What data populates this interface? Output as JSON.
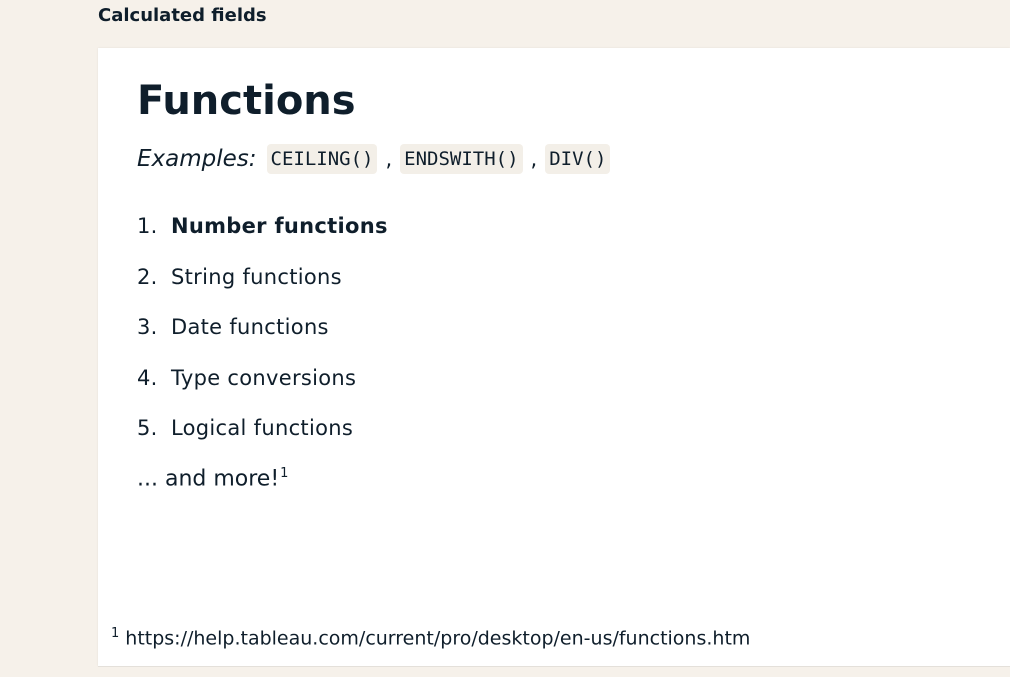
{
  "header": {
    "section_label": "Calculated fields"
  },
  "slide": {
    "title": "Functions",
    "examples_label": "Examples:",
    "examples": [
      "CEILING()",
      "ENDSWITH()",
      "DIV()"
    ],
    "separator": ",",
    "list": [
      {
        "num": "1.",
        "label": "Number functions",
        "active": true
      },
      {
        "num": "2.",
        "label": "String functions",
        "active": false
      },
      {
        "num": "3.",
        "label": "Date functions",
        "active": false
      },
      {
        "num": "4.",
        "label": "Type conversions",
        "active": false
      },
      {
        "num": "5.",
        "label": "Logical functions",
        "active": false
      }
    ],
    "more_text": "... and more!",
    "more_ref": "1",
    "footnote": {
      "marker": "1",
      "url": "https://help.tableau.com/current/pro/desktop/en-us/functions.htm"
    }
  }
}
